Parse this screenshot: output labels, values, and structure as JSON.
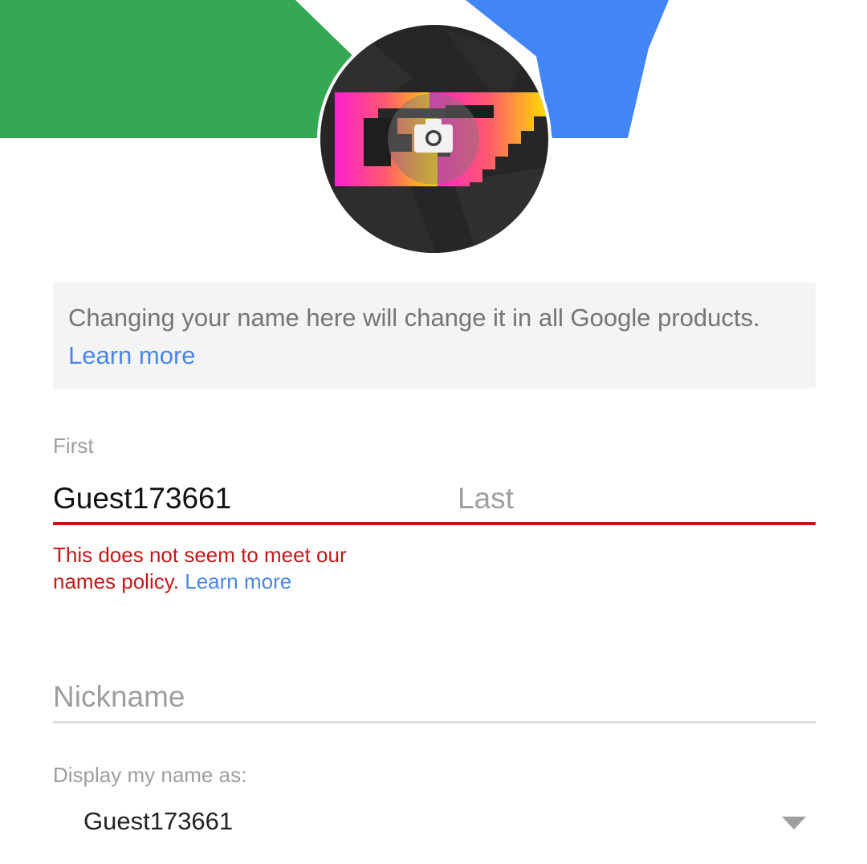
{
  "info": {
    "text": "Changing your name here will change it in all Google products.",
    "link": "Learn more"
  },
  "name_fields": {
    "first_label": "First",
    "first_value": "Guest173661",
    "last_placeholder": "Last",
    "last_value": ""
  },
  "error": {
    "text": "This does not seem to meet our names policy.",
    "link": "Learn more"
  },
  "nickname": {
    "placeholder": "Nickname",
    "value": ""
  },
  "display_name": {
    "label": "Display my name as:",
    "selected": "Guest173661"
  },
  "icons": {
    "camera": "camera-icon",
    "dropdown": "chevron-down-icon"
  },
  "colors": {
    "green": "#34a853",
    "blue": "#4285f4",
    "error": "#c41818",
    "link": "#4a86e8",
    "info_bg": "#f4f4f4"
  }
}
